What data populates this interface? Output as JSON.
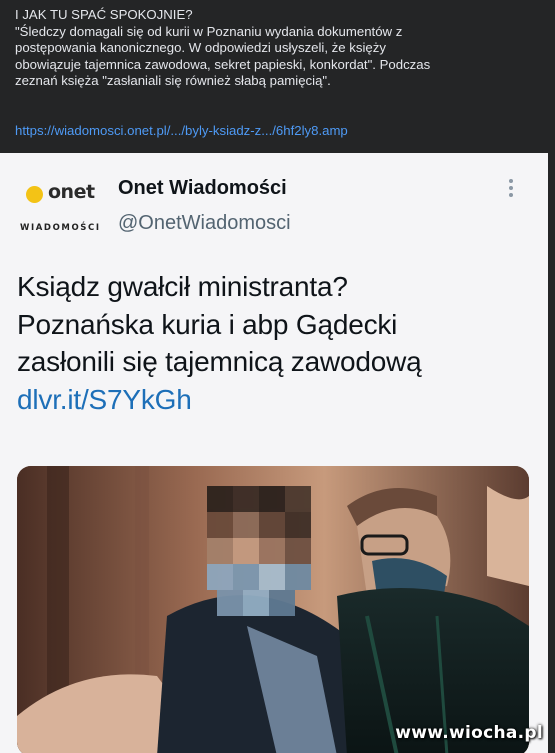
{
  "post": {
    "lines": [
      "I JAK TU SPAĆ SPOKOJNIE?",
      "\"Śledczy domagali się od kurii w Poznaniu wydania dokumentów z",
      "postępowania kanonicznego. W odpowiedzi usłyszeli, że księży",
      "obowiązuje tajemnica zawodowa, sekret papieski, konkordat\". Podczas",
      "zeznań księża \"zasłaniali się również słabą pamięcią\"."
    ],
    "link": "https://wiadomosci.onet.pl/.../byly-ksiadz-z.../6hf2ly8.amp"
  },
  "tweet": {
    "logo_top": "onet",
    "logo_bottom": "WIADOMOŚCI",
    "account_name": "Onet Wiadomości",
    "handle": "@OnetWiadomosci",
    "headline_lines": [
      "Ksiądz gwałcił ministranta?",
      "Poznańska kuria i abp Gądecki",
      "zasłonili się tajemnicą zawodową"
    ],
    "short_link": "dlvr.it/S7YkGh",
    "photo_alt": "pixelated-photo"
  },
  "watermark": "www.wiocha.pl",
  "colors": {
    "background": "#242526",
    "link": "#4e9af5",
    "tweet_bg": "#f5f5f7",
    "tweet_link": "#1d6fb8",
    "onet_yellow": "#f3c316"
  }
}
